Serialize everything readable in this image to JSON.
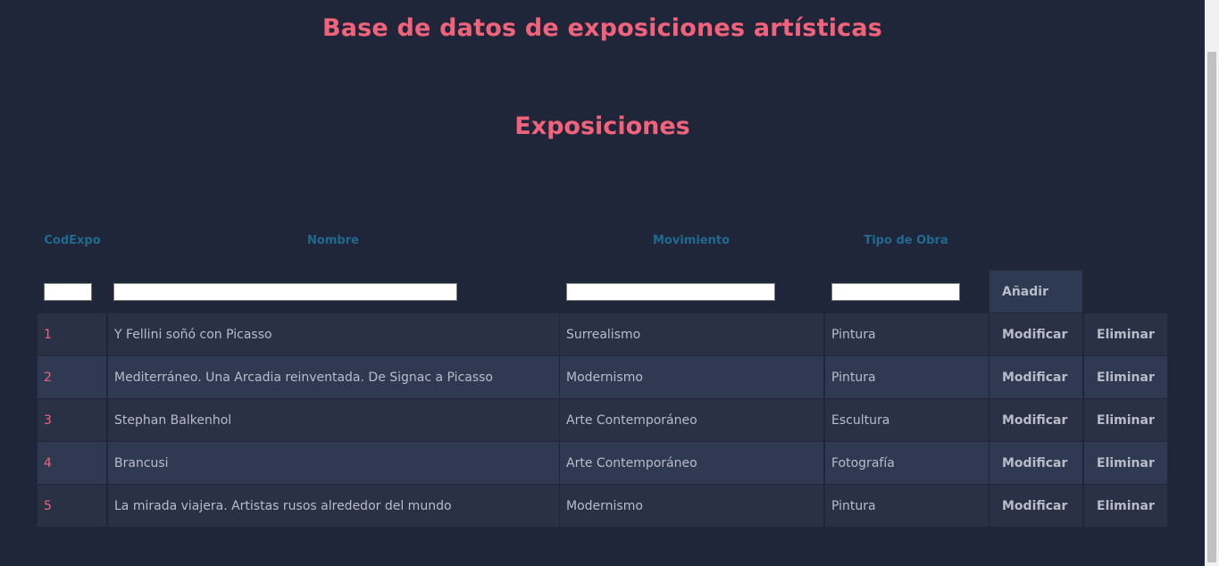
{
  "page": {
    "title": "Base de datos de exposiciones artísticas",
    "section_title": "Exposiciones"
  },
  "table": {
    "headers": {
      "code": "CodExpo",
      "name": "Nombre",
      "movement": "Movimiento",
      "type": "Tipo de Obra"
    },
    "inputs": {
      "code": "",
      "name": "",
      "movement": "",
      "type": ""
    },
    "add_label": "Añadir",
    "modify_label": "Modificar",
    "delete_label": "Eliminar",
    "rows": [
      {
        "code": "1",
        "name": "Y Fellini soñó con Picasso",
        "movement": "Surrealismo",
        "type": "Pintura"
      },
      {
        "code": "2",
        "name": "Mediterráneo. Una Arcadia reinventada. De Signac a Picasso",
        "movement": "Modernismo",
        "type": "Pintura"
      },
      {
        "code": "3",
        "name": "Stephan Balkenhol",
        "movement": "Arte Contemporáneo",
        "type": "Escultura"
      },
      {
        "code": "4",
        "name": "Brancusi",
        "movement": "Arte Contemporáneo",
        "type": "Fotografía"
      },
      {
        "code": "5",
        "name": "La mirada viajera. Artistas rusos alrededor del mundo",
        "movement": "Modernismo",
        "type": "Pintura"
      }
    ]
  },
  "colors": {
    "background": "#20263a",
    "accent": "#f2637b",
    "header_text": "#1f6a8e",
    "row_text": "#b7bcc8"
  }
}
